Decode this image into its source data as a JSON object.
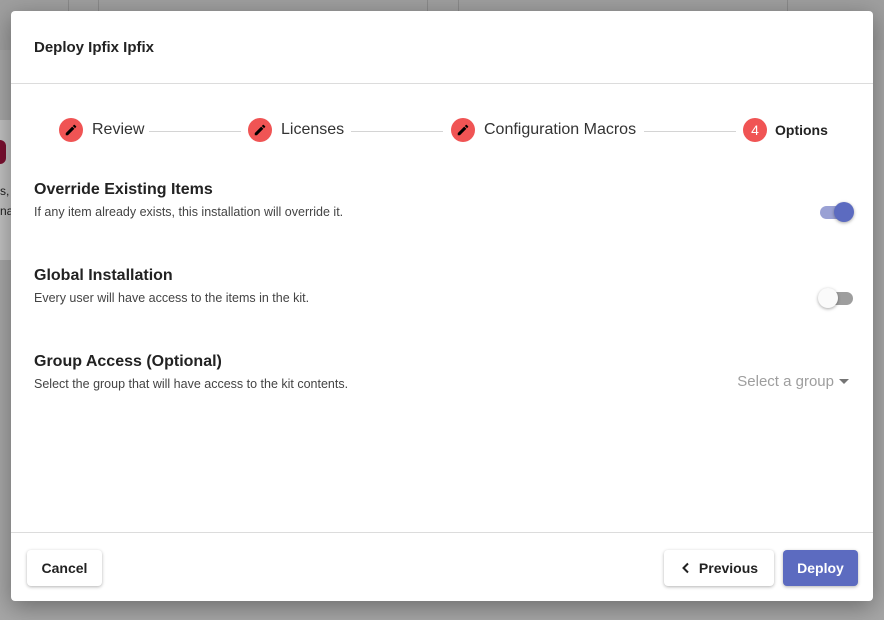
{
  "dialog": {
    "title": "Deploy Ipfix Ipfix"
  },
  "stepper": {
    "steps": [
      {
        "label": "Review",
        "icon": "pencil-icon",
        "state": "edited"
      },
      {
        "label": "Licenses",
        "icon": "pencil-icon",
        "state": "edited"
      },
      {
        "label": "Configuration Macros",
        "icon": "pencil-icon",
        "state": "edited"
      },
      {
        "label": "Options",
        "number": "4",
        "state": "active"
      }
    ],
    "accent_color": "#f05454"
  },
  "options": {
    "override": {
      "title": "Override Existing Items",
      "description": "If any item already exists, this installation will override it.",
      "enabled": true
    },
    "global": {
      "title": "Global Installation",
      "description": "Every user will have access to the items in the kit.",
      "enabled": false
    },
    "group": {
      "title": "Group Access (Optional)",
      "description": "Select the group that will have access to the kit contents.",
      "placeholder": "Select a group"
    }
  },
  "footer": {
    "cancel_label": "Cancel",
    "previous_label": "Previous",
    "deploy_label": "Deploy",
    "primary_color": "#5c6bc0"
  },
  "background": {
    "text_lines": [
      "s,",
      "na"
    ]
  }
}
